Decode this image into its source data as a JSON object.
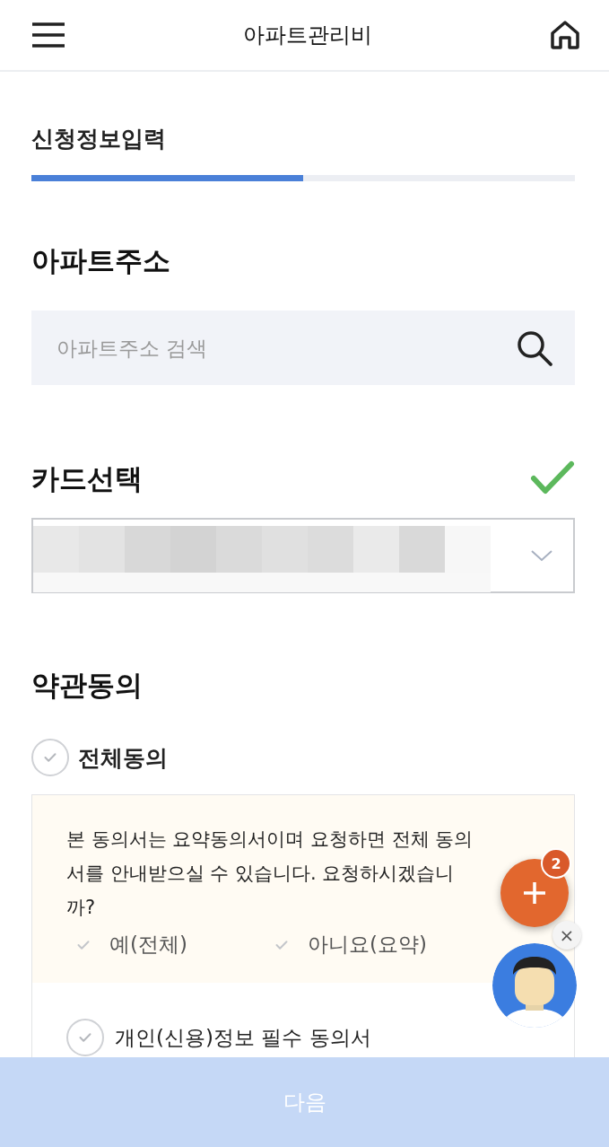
{
  "header": {
    "title": "아파트관리비"
  },
  "step": {
    "label": "신청정보입력",
    "level": 0.5
  },
  "address": {
    "heading": "아파트주소",
    "placeholder": "아파트주소 검색"
  },
  "card": {
    "heading": "카드선택",
    "complete": true
  },
  "terms": {
    "heading": "약관동의",
    "all": {
      "label": "전체동의",
      "checked": false
    },
    "notice": "본 동의서는 요약동의서이며 요청하면 전체 동의서를 안내받으실 수 있습니다. 요청하시겠습니까?",
    "options": [
      {
        "label": "예(전체)",
        "checked": false
      },
      {
        "label": "아니요(요약)",
        "checked": false
      }
    ],
    "items": [
      {
        "label": "개인(신용)정보 필수 동의서",
        "checked": false
      }
    ]
  },
  "fab": {
    "badge": "2",
    "close": "×"
  },
  "next_button": {
    "label": "다음",
    "disabled": true
  }
}
